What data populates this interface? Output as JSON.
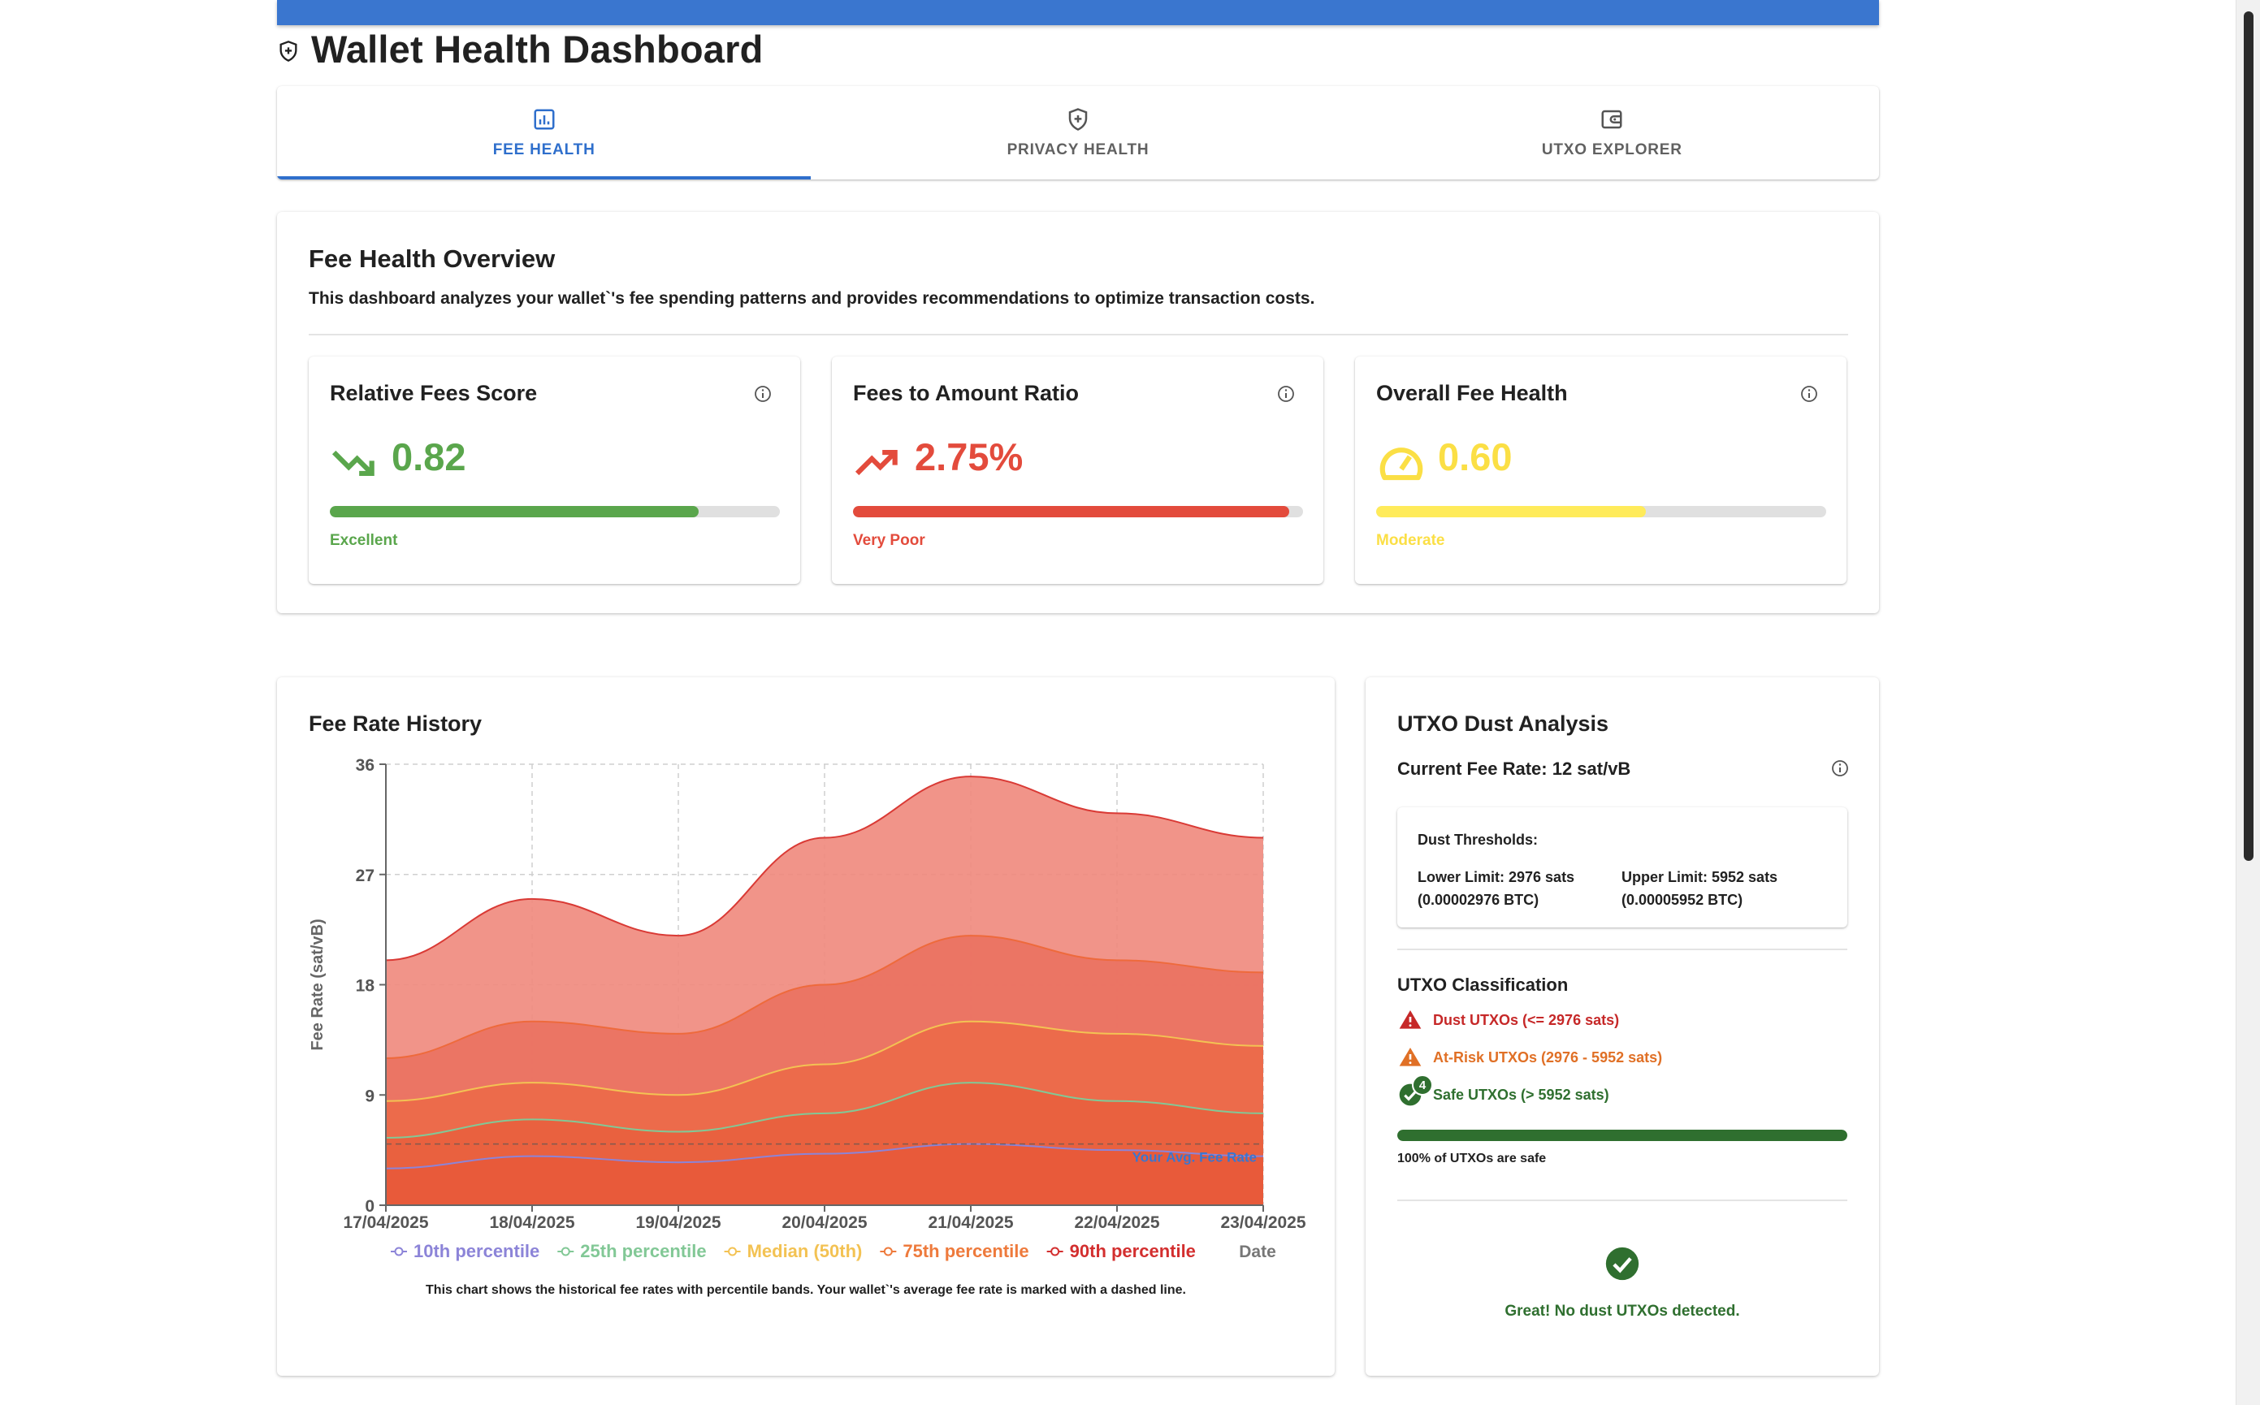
{
  "page": {
    "title": "Wallet Health Dashboard"
  },
  "tabs": [
    {
      "label": "FEE HEALTH",
      "icon": "bar-chart-icon",
      "active": true
    },
    {
      "label": "PRIVACY HEALTH",
      "icon": "shield-plus-icon",
      "active": false
    },
    {
      "label": "UTXO EXPLORER",
      "icon": "wallet-icon",
      "active": false
    }
  ],
  "overview": {
    "title": "Fee Health Overview",
    "description": "This dashboard analyzes your wallet`'s fee spending patterns and provides recommendations to optimize transaction costs."
  },
  "metrics": [
    {
      "title": "Relative Fees Score",
      "value": "0.82",
      "rating": "Excellent",
      "progress": 0.82,
      "color": "#5aa64c",
      "icon": "trending-down-icon"
    },
    {
      "title": "Fees to Amount Ratio",
      "value": "2.75%",
      "rating": "Very Poor",
      "progress": 0.97,
      "color": "#e34b3c",
      "icon": "trending-up-icon"
    },
    {
      "title": "Overall Fee Health",
      "value": "0.60",
      "rating": "Moderate",
      "progress": 0.6,
      "color": "#ffeb5a",
      "icon": "speedometer-icon"
    }
  ],
  "history": {
    "title": "Fee Rate History",
    "note": "This chart shows the historical fee rates with percentile bands. Your wallet`'s average fee rate is marked with a dashed line."
  },
  "chart_data": {
    "type": "area",
    "title": "Fee Rate History",
    "xlabel": "Date",
    "ylabel": "Fee Rate (sat/vB)",
    "x": [
      "17/04/2025",
      "18/04/2025",
      "19/04/2025",
      "20/04/2025",
      "21/04/2025",
      "22/04/2025",
      "23/04/2025"
    ],
    "yticks": [
      0,
      9,
      18,
      27,
      36
    ],
    "ylim": [
      0,
      36
    ],
    "grid": true,
    "legend_position": "bottom",
    "series": [
      {
        "name": "10th percentile",
        "values": [
          3,
          4,
          3.5,
          4.2,
          5,
          4.5,
          4
        ],
        "color": "#8c84d8",
        "fill": "#e85a3a",
        "legend_color": "#8c84d8"
      },
      {
        "name": "25th percentile",
        "values": [
          5.5,
          7,
          6,
          7.5,
          10,
          8.5,
          7.5
        ],
        "color": "#82c896",
        "fill": "#e9603e",
        "legend_color": "#82c896"
      },
      {
        "name": "Median (50th)",
        "values": [
          8.5,
          10,
          9,
          11.5,
          15,
          14,
          13
        ],
        "color": "#f3c253",
        "fill": "#ec6a48",
        "legend_color": "#f3c253"
      },
      {
        "name": "75th percentile",
        "values": [
          12,
          15,
          14,
          18,
          22,
          20,
          19
        ],
        "color": "#ee6a3c",
        "fill": "#ea7160",
        "legend_color": "#ee7a3c"
      },
      {
        "name": "90th percentile",
        "values": [
          20,
          25,
          22,
          30,
          35,
          32,
          30
        ],
        "color": "#d93a35",
        "fill": "#f0887c",
        "legend_color": "#d32f2f"
      }
    ],
    "reference_line": {
      "label": "Your Avg. Fee Rate",
      "value": 5,
      "color": "#3a76cf"
    }
  },
  "dust": {
    "title": "UTXO Dust Analysis",
    "current_fee_rate": "Current Fee Rate: 12 sat/vB",
    "thresholds_heading": "Dust Thresholds:",
    "lower_limit": "Lower Limit: 2976 sats",
    "lower_btc": "(0.00002976 BTC)",
    "upper_limit": "Upper Limit: 5952 sats",
    "upper_btc": "(0.00005952 BTC)",
    "classification_title": "UTXO Classification",
    "dust_label": "Dust UTXOs (<= 2976 sats)",
    "atrisk_label": "At-Risk UTXOs (2976 - 5952 sats)",
    "safe_label": "Safe UTXOs (> 5952 sats)",
    "safe_count": "4",
    "safe_fraction": 1.0,
    "safe_caption": "100% of UTXOs are safe",
    "ok_message": "Great! No dust UTXOs detected.",
    "colors": {
      "dust": "#c62828",
      "atrisk": "#e07026",
      "safe": "#2f6f2f"
    }
  }
}
